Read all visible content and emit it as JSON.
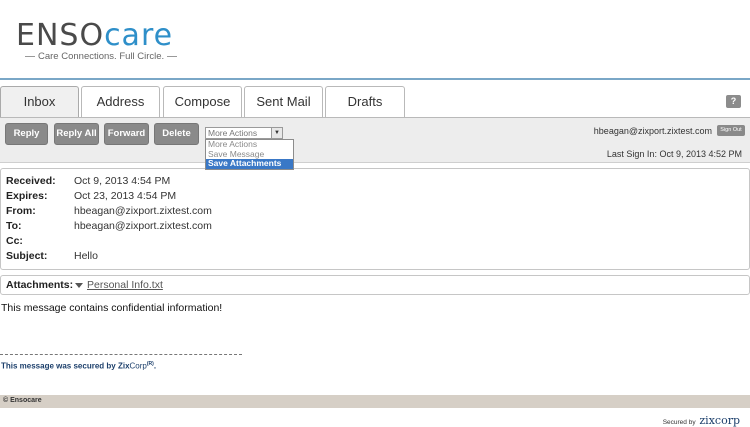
{
  "brand": {
    "logo_prefix": "ENSO",
    "logo_suffix": "care",
    "tagline": "Care Connections. Full Circle.",
    "accent_color": "#2e8fc9"
  },
  "tabs": [
    {
      "label": "Inbox",
      "active": true
    },
    {
      "label": "Address",
      "active": false
    },
    {
      "label": "Compose",
      "active": false
    },
    {
      "label": "Sent Mail",
      "active": false
    },
    {
      "label": "Drafts",
      "active": false
    }
  ],
  "help_label": "?",
  "toolbar": {
    "reply_label": "Reply",
    "reply_all_label": "Reply All",
    "forward_label": "Forward",
    "delete_label": "Delete",
    "more_actions_value": "More Actions",
    "user_email": "hbeagan@zixport.zixtest.com",
    "signout_label": "Sign Out",
    "last_signin": "Last Sign In: Oct 9, 2013 4:52 PM"
  },
  "dropdown": {
    "options": [
      "More Actions",
      "Save Message",
      "Save Attachments"
    ],
    "selected_index": 2
  },
  "message": {
    "fields": [
      {
        "label": "Received:",
        "value": "Oct 9, 2013 4:54 PM"
      },
      {
        "label": "Expires:",
        "value": "Oct 23, 2013 4:54 PM"
      },
      {
        "label": "From:",
        "value": "hbeagan@zixport.zixtest.com"
      },
      {
        "label": "To:",
        "value": "hbeagan@zixport.zixtest.com"
      },
      {
        "label": "Cc:",
        "value": ""
      },
      {
        "label": "Subject:",
        "value": "Hello"
      }
    ],
    "attachments_label": "Attachments:",
    "attachment_name": "Personal Info.txt",
    "body": "This message contains confidential information!"
  },
  "signature": {
    "prefix": "This message was secured by ",
    "brand_a": "Zix",
    "brand_b": "Corp",
    "mark": "(R)",
    "suffix": "."
  },
  "footer": {
    "copyright": "© Ensocare",
    "secured_by": "Secured by",
    "secured_brand": "zixcorp"
  }
}
